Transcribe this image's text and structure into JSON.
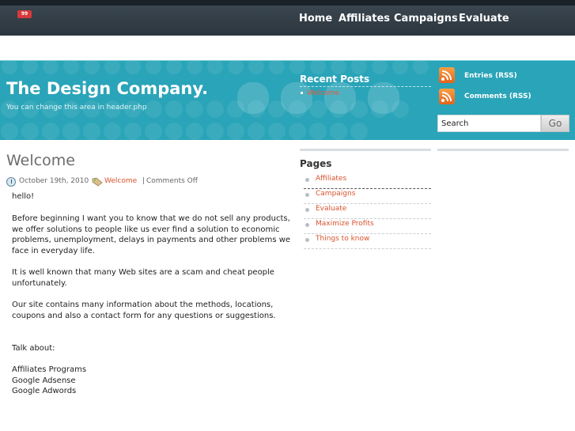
{
  "top_nav": {
    "badge": "99",
    "items": [
      "Home",
      "Affiliates",
      "Campaigns",
      "Evaluate"
    ]
  },
  "header": {
    "site_title": "The Design Company.",
    "site_description": "You can change this area in header.php",
    "recent_posts": {
      "heading": "Recent Posts",
      "items": [
        "Welcome"
      ]
    },
    "feeds": {
      "entries_label": "Entries (RSS)",
      "comments_label": "Comments (RSS)"
    },
    "search": {
      "value": "Search",
      "button_label": "Go"
    }
  },
  "post": {
    "title": "Welcome",
    "date": "October 19th, 2010",
    "category": "Welcome",
    "separator": "|",
    "comments": "Comments Off",
    "body": [
      "hello!",
      "Before beginning I want you to know that we do not sell any products,",
      "we offer solutions to people like us ever find a solution to economic",
      "problems, unemployment, delays in payments and other problems we",
      "face in everyday life.",
      "It is well known that many Web sites are a scam and cheat people",
      "unfortunately.",
      "Our site contains many information about the methods, locations,",
      "coupons and also a contact form for any questions or suggestions.",
      "Talk about:",
      "Affiliates Programs",
      "Google Adsense",
      "Google Adwords"
    ]
  },
  "sidebar": {
    "pages_heading": "Pages",
    "pages": [
      "Affiliates",
      "Campaigns",
      "Evaluate",
      "Maximize Profits",
      "Things to know"
    ]
  },
  "colors": {
    "nav_bar": "#2f3a43",
    "header_teal": "#2aa4b8",
    "link_orange": "#d8532e"
  },
  "icons": [
    "rss-icon",
    "clock-icon",
    "tag-icon"
  ]
}
